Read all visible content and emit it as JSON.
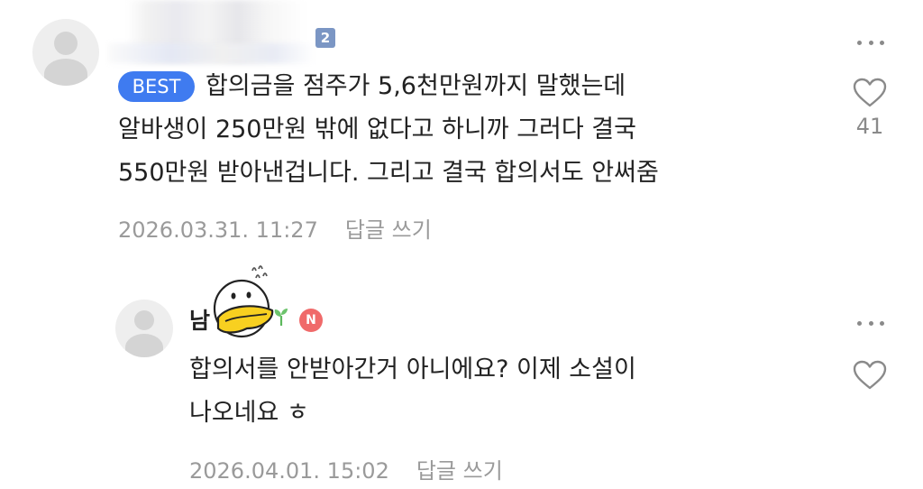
{
  "comment1": {
    "level_badge": "2",
    "best_badge": "BEST",
    "lines": [
      "합의금을 점주가 5,6천만원까지 말했는데",
      "알바생이 250만원 밖에 없다고 하니까 그러다 결국",
      "550만원 받아낸겁니다. 그리고 결국 합의서도 안써줌"
    ],
    "date": "2026.03.31. 11:27",
    "reply_label": "답글 쓰기",
    "like_count": "41",
    "more_icon": "more-dots-icon",
    "like_icon": "heart-outline-icon"
  },
  "comment2": {
    "nickname": "남",
    "badge": "N",
    "lines": [
      "합의서를 안받아간거 아니에요? 이제 소설이",
      "나오네요 ㅎ"
    ],
    "date": "2026.04.01. 15:02",
    "reply_label": "답글 쓰기",
    "more_icon": "more-dots-icon",
    "like_icon": "heart-outline-icon"
  },
  "colors": {
    "best_badge": "#3f7bf0",
    "level_badge": "#7b96c4",
    "new_badge": "#f06a6a",
    "meta_text": "#9a9a9a",
    "sticker_yellow": "#f8d020"
  }
}
